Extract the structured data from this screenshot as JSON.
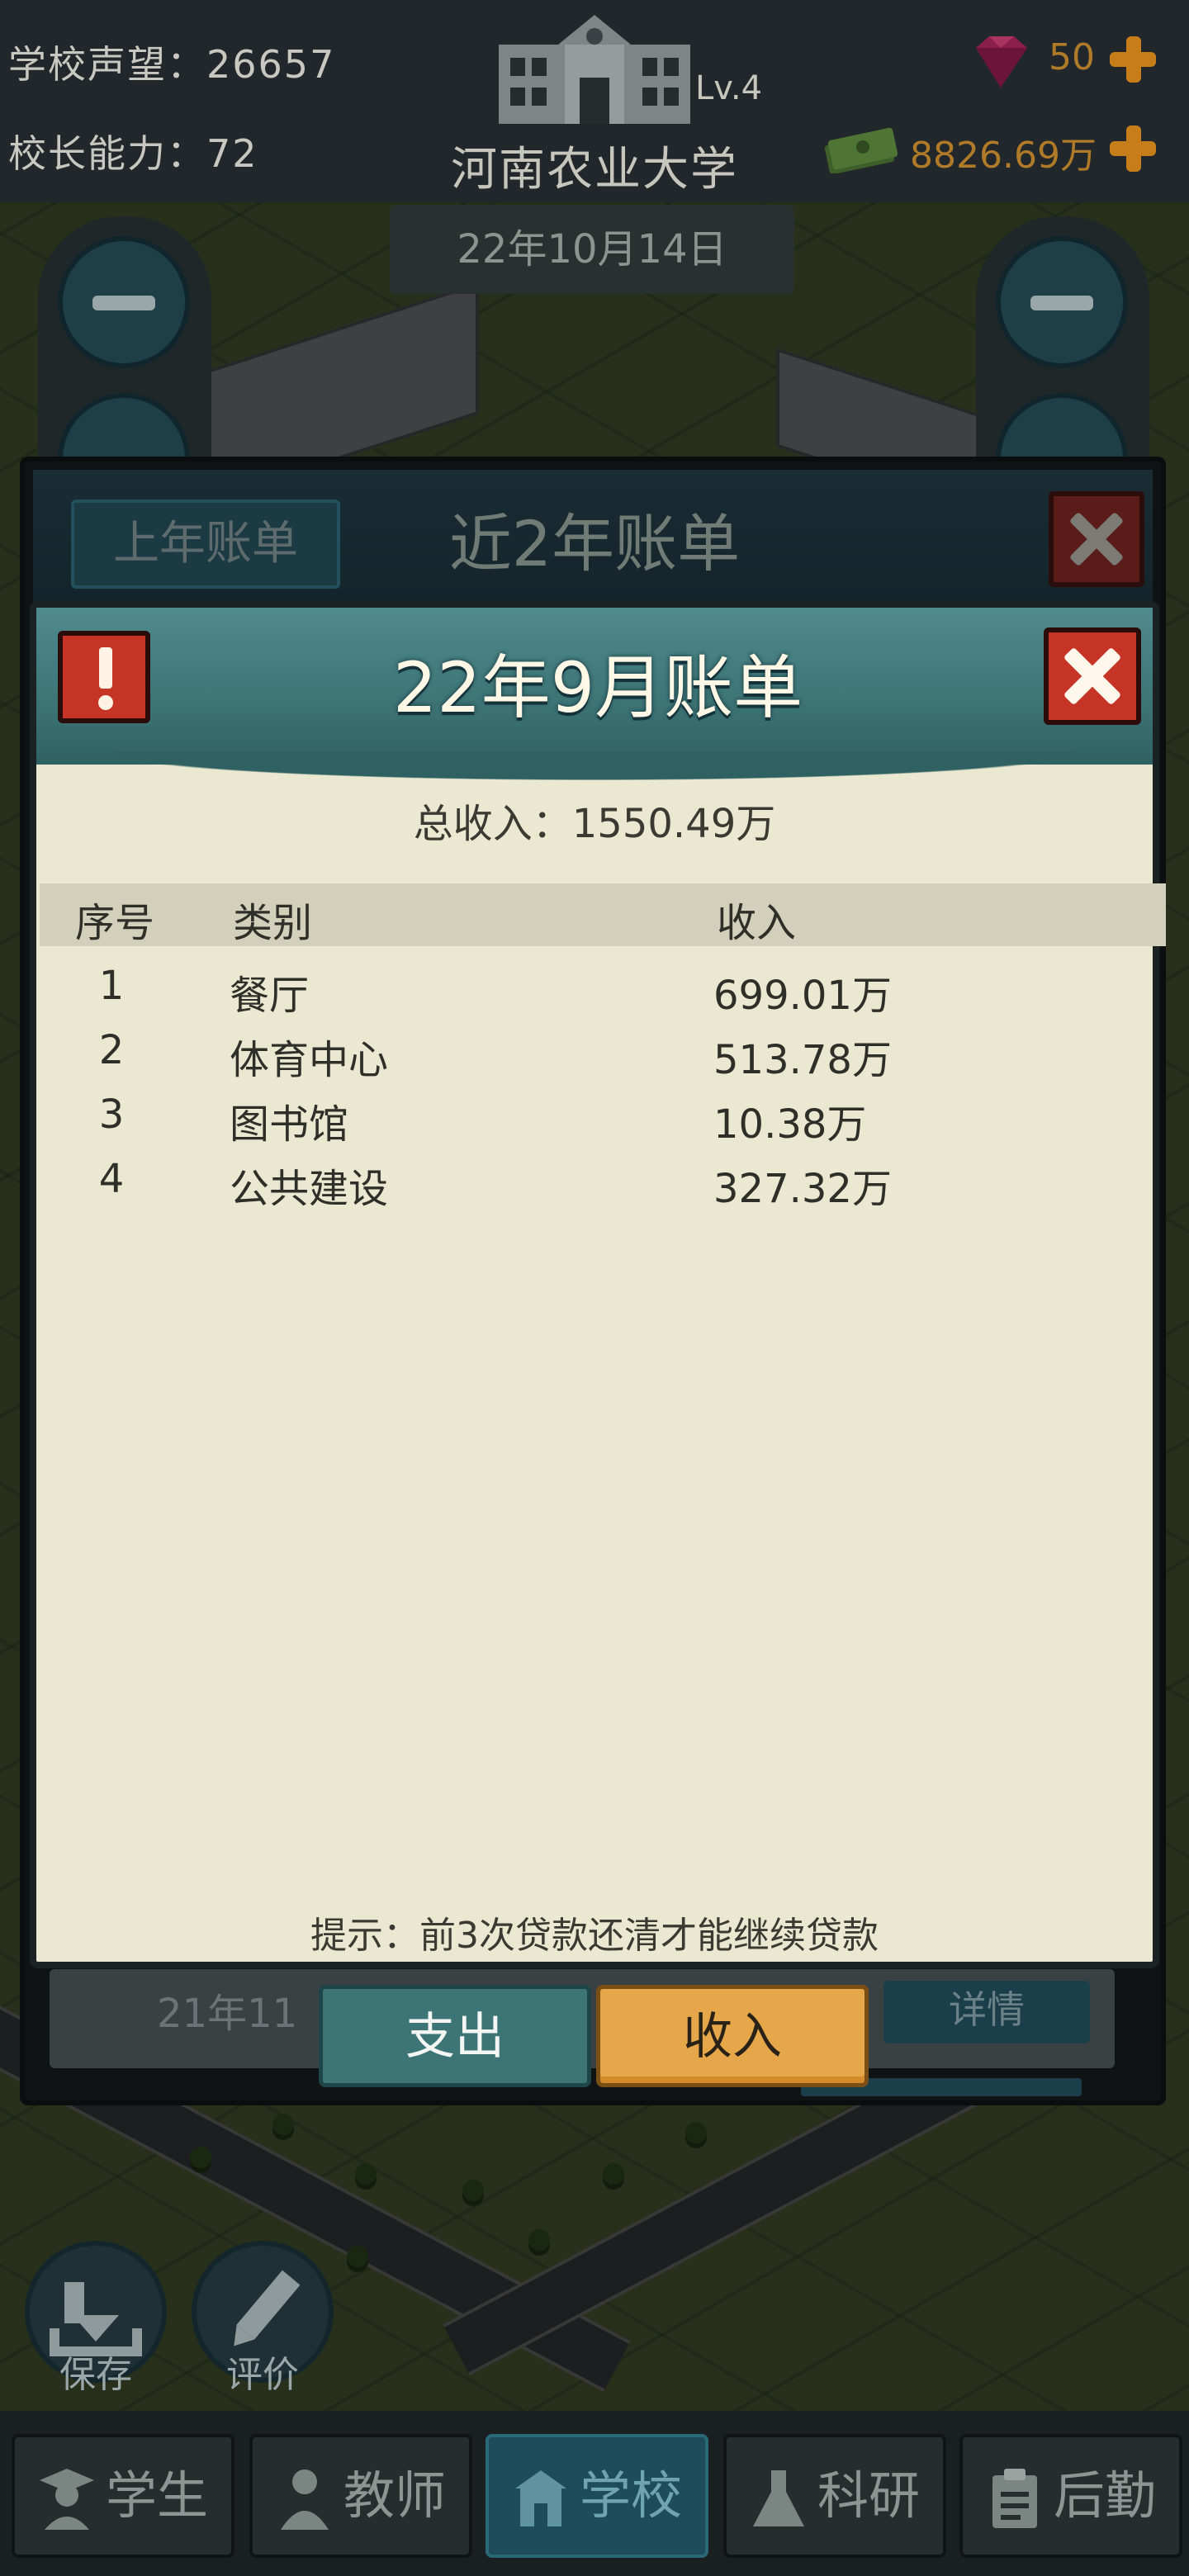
{
  "hud": {
    "reputation_label": "学校声望：",
    "reputation_value": "26657",
    "ability_label": "校长能力：",
    "ability_value": "72",
    "school_level": "Lv.4",
    "school_name": "河南农业大学",
    "gems": "50",
    "money": "8826.69万",
    "date": "22年10月14日"
  },
  "outer_window": {
    "last_year_button": "上年账单",
    "title": "近2年账单",
    "row_text": "21年11",
    "detail_button": "详情"
  },
  "dialog": {
    "title": "22年9月账单",
    "total_label": "总收入：",
    "total_value": "1550.49万",
    "columns": [
      "序号",
      "类别",
      "收入"
    ],
    "rows": [
      {
        "idx": "1",
        "category": "餐厅",
        "income": "699.01万"
      },
      {
        "idx": "2",
        "category": "体育中心",
        "income": "513.78万"
      },
      {
        "idx": "3",
        "category": "图书馆",
        "income": "10.38万"
      },
      {
        "idx": "4",
        "category": "公共建设",
        "income": "327.32万"
      }
    ],
    "tip": "提示：前3次贷款还清才能继续贷款"
  },
  "tabs": {
    "expense": "支出",
    "income": "收入",
    "active": "income"
  },
  "actions": {
    "save": "保存",
    "review": "评价"
  },
  "nav": {
    "items": [
      {
        "label": "学生",
        "icon": "student-icon"
      },
      {
        "label": "教师",
        "icon": "teacher-icon"
      },
      {
        "label": "学校",
        "icon": "school-icon"
      },
      {
        "label": "科研",
        "icon": "flask-icon"
      },
      {
        "label": "后勤",
        "icon": "clipboard-icon"
      }
    ],
    "active": "学校"
  },
  "colors": {
    "accent_teal": "#3f7779",
    "income_orange": "#e6a64a",
    "close_red": "#c63426",
    "dialog_bg": "#eae8d0"
  }
}
